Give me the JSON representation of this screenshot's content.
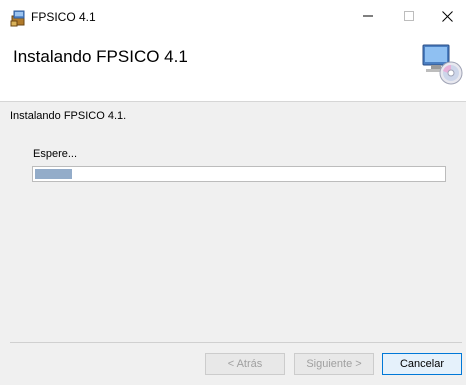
{
  "window": {
    "title": "FPSICO 4.1",
    "controls": {
      "minimize": "—",
      "maximize": "☐",
      "close": "✕"
    }
  },
  "header": {
    "title": "Instalando FPSICO 4.1",
    "icon": "computer-cd-icon"
  },
  "main": {
    "status": "Instalando FPSICO 4.1.",
    "wait_label": "Espere...",
    "progress": 0.09
  },
  "footer": {
    "back_label": "< Atrás",
    "next_label": "Siguiente >",
    "cancel_label": "Cancelar"
  },
  "colors": {
    "progress_fill": "#93acc9",
    "panel_bg": "#f0f0f0",
    "focus_border": "#0078d7"
  }
}
